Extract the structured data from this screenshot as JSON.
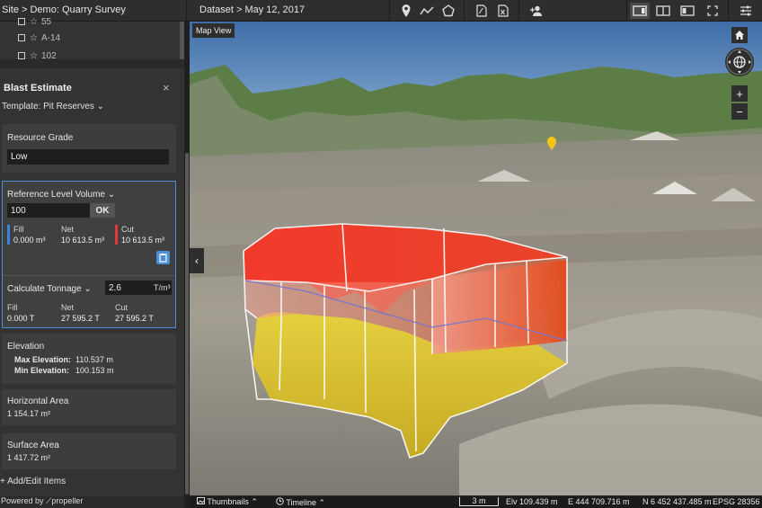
{
  "topbar": {
    "site": "Site > Demo: Quarry Survey",
    "dataset": "Dataset > May 12, 2017",
    "icons": [
      "pin-icon",
      "polyline-icon",
      "polygon-icon",
      "pdf-icon",
      "excel-icon",
      "add-user-icon",
      "split-view-icon",
      "two-pane-icon",
      "compare-icon",
      "fullscreen-icon",
      "settings-sliders-icon"
    ]
  },
  "layers": [
    {
      "label": "55"
    },
    {
      "label": "A-14"
    },
    {
      "label": "102"
    }
  ],
  "panel": {
    "title": "Blast Estimate",
    "close": "×",
    "template": "Template: Pit Reserves ⌄"
  },
  "grade": {
    "label": "Resource Grade",
    "value": "Low"
  },
  "volume": {
    "label": "Reference Level Volume ⌄",
    "value": "100",
    "ok": "OK",
    "fill_label": "Fill",
    "fill_value": "0.000 m³",
    "net_label": "Net",
    "net_value": "10 613.5 m³",
    "cut_label": "Cut",
    "cut_value": "10 613.5 m³",
    "tonnage_label": "Calculate Tonnage ⌄",
    "tonnage_value": "2.6",
    "tonnage_unit": "T/m³",
    "t_fill_label": "Fill",
    "t_fill_value": "0.000 T",
    "t_net_label": "Net",
    "t_net_value": "27 595.2 T",
    "t_cut_label": "Cut",
    "t_cut_value": "27 595.2 T"
  },
  "elevation": {
    "label": "Elevation",
    "max_label": "Max Elevation:",
    "max_value": "110.537 m",
    "min_label": "Min Elevation:",
    "min_value": "100.153 m"
  },
  "horizontal": {
    "label": "Horizontal Area",
    "value": "1 154.17 m²"
  },
  "surface": {
    "label": "Surface Area",
    "value": "1 417.72 m²"
  },
  "footer": {
    "add": "+ Add/Edit Items",
    "powered": "Powered by ⟋propeller"
  },
  "map": {
    "view_button": "Map View",
    "collapse": "‹",
    "home": "⌂",
    "zoom_in": "+",
    "zoom_out": "−"
  },
  "bottombar": {
    "thumbnails": "Thumbnails ⌃",
    "timeline": "Timeline ⌃",
    "scale": "3 m",
    "elevation": "Elv 109.439 m",
    "easting": "E 444 709.716 m",
    "northing": "N 6 452 437.485 m",
    "epsg": "EPSG 28356"
  },
  "colors": {
    "accent": "#4a90d9",
    "fill_bar": "#3d7fe0",
    "cut_bar": "#e03a3a"
  }
}
